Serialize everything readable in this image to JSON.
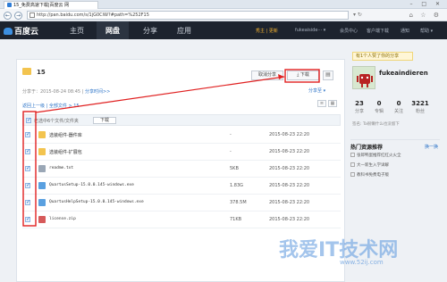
{
  "browser": {
    "tab_title": "15_免费高速下载|百度云 网",
    "url": "http://pan.baidu.com/s/1jG0CiW?#path=%252F15",
    "nav_back": "←",
    "nav_forward": "→",
    "window_controls": "– □ ✕",
    "tool_icons": "⌂ ☆ ⚙",
    "url_icons": "▾ ↻"
  },
  "site": {
    "logo_text": "百度云",
    "nav": [
      "主页",
      "网盘",
      "分享",
      "应用"
    ],
    "nav_active": "网盘",
    "vip_text": "秀主 | 更新",
    "user": "fukeaiside··· ▾",
    "links": [
      "会员中心",
      "客户端下载",
      "通知",
      "帮助 ▾"
    ],
    "notice_badge": "8"
  },
  "share": {
    "folder_name": "15",
    "share_time": "分享于：2015-08-24 08:45 |",
    "tag_text": "分享时间>>",
    "cancel_share": "取消分享",
    "download": "下载",
    "more": "▤",
    "report": "分享至 ▾",
    "breadcrumb": "返回上一级 | 全部文件 > 15",
    "selection_info": "已选中6个文件/文件夹",
    "header_download": "下载"
  },
  "files": [
    {
      "name": "选装组件-器件库",
      "size": "-",
      "date": "2015-08-23 22:20",
      "type": "folder"
    },
    {
      "name": "选装组件-扩展包",
      "size": "-",
      "date": "2015-08-23 22:20",
      "type": "folder"
    },
    {
      "name": "readme.txt",
      "size": "5KB",
      "date": "2015-08-23 22:20",
      "type": "txt"
    },
    {
      "name": "QuartusSetup-15.0.0.145-windows.exe",
      "size": "1.83G",
      "date": "2015-08-23 22:20",
      "type": "exe"
    },
    {
      "name": "QuartusHelpSetup-15.0.0.145-windows.exe",
      "size": "378.5M",
      "date": "2015-08-23 22:20",
      "type": "exe"
    },
    {
      "name": "license.zip",
      "size": "71KB",
      "date": "2015-08-23 22:20",
      "type": "zip"
    }
  ],
  "sidebar": {
    "like_banner": "有1个人赞了你的分享",
    "username": "fukeaindieren",
    "stats": [
      {
        "n": "23",
        "l": "分享"
      },
      {
        "n": "0",
        "l": "专辑"
      },
      {
        "n": "0",
        "l": "关注"
      },
      {
        "n": "3221",
        "l": "粉丝"
      }
    ],
    "signature": "签名: Ta很懒什么也没留下",
    "hot_title": "热门资源推荐",
    "refresh": "换一换",
    "hot_items": [
      "张郎鸭蛋推荐红红火火全",
      "大一新生入学详解",
      "教科书免费电子版"
    ]
  },
  "watermark": {
    "text": "我爱IT技术网",
    "url": "www.52ij.com"
  },
  "colors": {
    "nav_bg": "#1d232e",
    "link_blue": "#2b73c7",
    "annotation_red": "#e02020"
  }
}
